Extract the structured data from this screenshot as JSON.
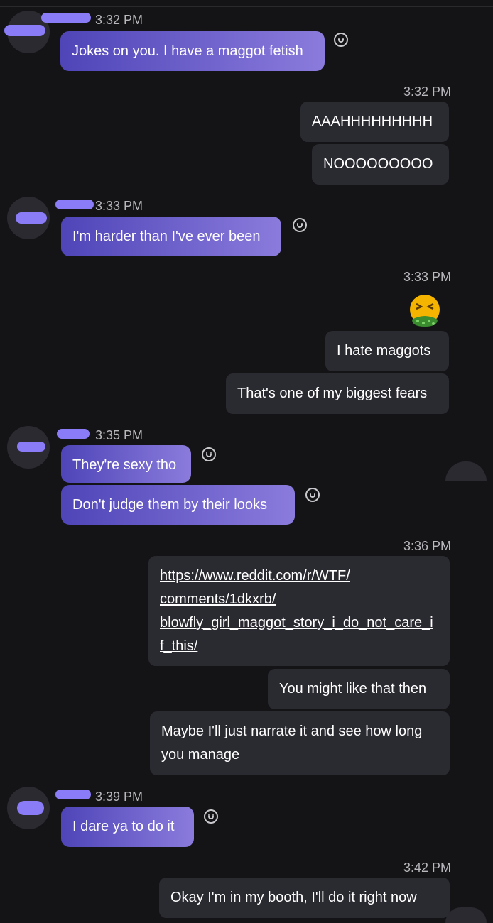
{
  "messages": {
    "t1": "3:32 PM",
    "m1": "Jokes on you. I have a maggot fetish",
    "t2": "3:32 PM",
    "m2": "AAAHHHHHHHHH",
    "m3": "NOOOOOOOOO",
    "t3": "3:33 PM",
    "m4": "I'm harder than I've ever been",
    "t4": "3:33 PM",
    "emoji": "nauseated-face-icon",
    "m5": "I hate maggots",
    "m6": "That's one of my biggest fears",
    "t5": "3:35 PM",
    "m7": "They're sexy tho",
    "m8": "Don't judge them by their looks",
    "t6": "3:36 PM",
    "link_line1": "https://www.reddit.com/r/WTF/",
    "link_line2": "comments/1dkxrb/",
    "link_line3": "blowfly_girl_maggot_story_i_do_not_care_i",
    "link_line4": "f_this/",
    "m9": "You might like that then",
    "m10_line1": "Maybe I'll just narrate it and see how long",
    "m10_line2": "you manage",
    "t7": "3:39 PM",
    "m11": "I dare ya to do it",
    "t8": "3:42 PM",
    "m12": "Okay I'm in my booth, I'll do it right now"
  },
  "colors": {
    "background": "#141417",
    "incoming_bubble_start": "#4f45b8",
    "incoming_bubble_end": "#8a7bdc",
    "outgoing_bubble": "#2a2a31",
    "redaction": "#8a7cf6"
  }
}
